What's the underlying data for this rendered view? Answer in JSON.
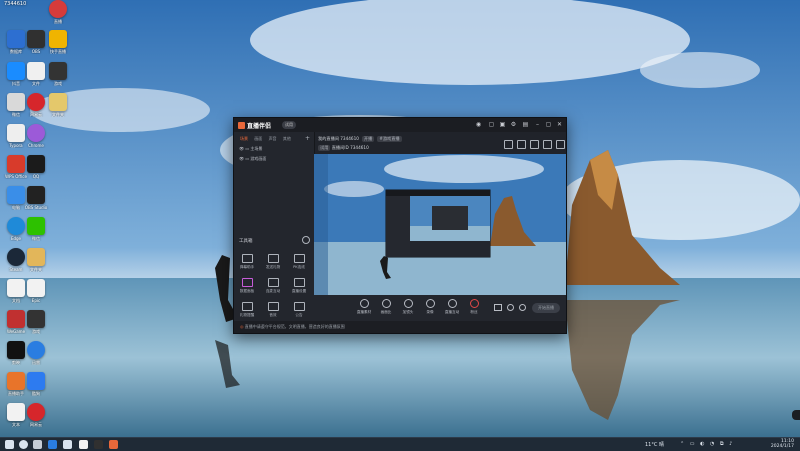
{
  "desktop": {
    "top_badge": "7344610",
    "icons": [
      {
        "label": "数据库",
        "color": "#2d6fd1"
      },
      {
        "label": "直播",
        "color": "#d63b3b"
      },
      {
        "label": "快手直播",
        "color": "#f0b400"
      },
      {
        "label": "OBS",
        "color": "#303030"
      },
      {
        "label": "录屏",
        "color": "#1c1c1c"
      },
      {
        "label": "抖音",
        "color": "#1a8cff"
      },
      {
        "label": "文件",
        "color": "#f0f0f0"
      },
      {
        "label": "游戏",
        "color": "#333"
      },
      {
        "label": "微信",
        "color": "#d9d9d9"
      },
      {
        "label": "网易云",
        "color": "#d6262b"
      },
      {
        "label": "文件夹",
        "color": "#e4c86b"
      },
      {
        "label": "Typora",
        "color": "#eeeeee"
      },
      {
        "label": "Chrome",
        "color": "#9c5ad8"
      },
      {
        "label": "WPS Office",
        "color": "#d83b2b"
      },
      {
        "label": "QQ",
        "color": "#1b1b1b"
      },
      {
        "label": "电脑",
        "color": "#3a8ee8"
      },
      {
        "label": "OBS Studio",
        "color": "#222"
      },
      {
        "label": "Edge",
        "color": "#1f8ad8"
      },
      {
        "label": "微信",
        "color": "#2dc100"
      },
      {
        "label": "Steam",
        "color": "#1b2838"
      },
      {
        "label": "文档",
        "color": "#f2f2f2"
      },
      {
        "label": "Epic",
        "color": "#f2f2f2"
      },
      {
        "label": "文件夹",
        "color": "#e2b65a"
      },
      {
        "label": "WeGame",
        "color": "#c03030"
      },
      {
        "label": "剪映",
        "color": "#111"
      },
      {
        "label": "迅雷",
        "color": "#2a7de1"
      },
      {
        "label": "直播助手",
        "color": "#e8742a"
      },
      {
        "label": "酷狗",
        "color": "#2d7bf0"
      },
      {
        "label": "文本",
        "color": "#f2f2f2"
      },
      {
        "label": "网易云",
        "color": "#d6262b"
      }
    ]
  },
  "app": {
    "name": "直播伴侣",
    "edition": "试用",
    "tabs": [
      "场景",
      "画面",
      "声音",
      "其他"
    ],
    "sources": [
      "主场景",
      "游戏画面"
    ],
    "stream_title": "我的直播间 7344610",
    "status_badge": "开播",
    "tag1": "#游戏直播",
    "viewer_line": "直播间ID 7344610",
    "tool_section_title": "工具箱",
    "tools": [
      "弹幕助手",
      "发送礼物",
      "PK连线",
      "数据面板",
      "连麦互动",
      "直播设置",
      "礼物提醒",
      "音效",
      "公告"
    ],
    "bottom_buttons": [
      "直播素材",
      "画面比",
      "加镜头",
      "录像",
      "直播互动",
      "粉丝"
    ],
    "go_live": "开始直播",
    "info_text": "直播中请遵守平台规范，文明直播，营造良好的直播氛围"
  },
  "taskbar": {
    "weather": "11°C 晴",
    "time": "11:10",
    "date": "2024/1/17"
  }
}
